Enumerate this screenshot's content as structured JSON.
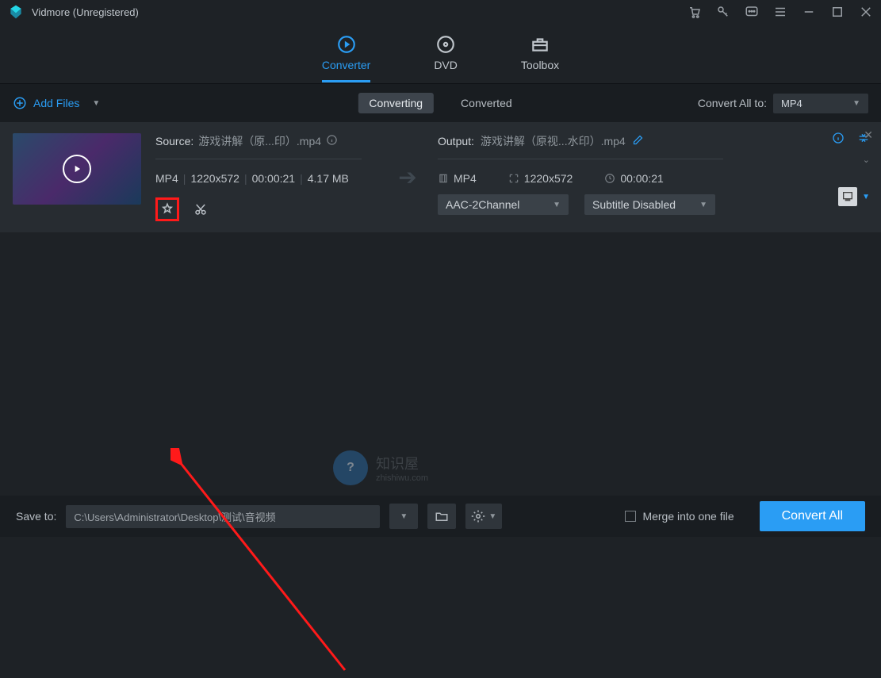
{
  "titlebar": {
    "title": "Vidmore (Unregistered)"
  },
  "nav": {
    "converter": "Converter",
    "dvd": "DVD",
    "toolbox": "Toolbox"
  },
  "subbar": {
    "add_files": "Add Files",
    "converting": "Converting",
    "converted": "Converted",
    "convert_all_to_label": "Convert All to:",
    "convert_all_to_value": "MP4"
  },
  "file": {
    "source_label": "Source:",
    "source_file": "游戏讲解（原...印）.mp4",
    "format": "MP4",
    "resolution": "1220x572",
    "duration": "00:00:21",
    "size": "4.17 MB",
    "output_label": "Output:",
    "output_file": "游戏讲解（原视...水印）.mp4",
    "out_format": "MP4",
    "out_resolution": "1220x572",
    "out_duration": "00:00:21",
    "audio_select": "AAC-2Channel",
    "subtitle_select": "Subtitle Disabled",
    "format_badge": "MP4"
  },
  "watermark": {
    "t1": "知识屋",
    "t2": "zhishiwu.com"
  },
  "footer": {
    "save_to_label": "Save to:",
    "save_path": "C:\\Users\\Administrator\\Desktop\\测试\\音视频",
    "merge_label": "Merge into one file",
    "convert_btn": "Convert All"
  }
}
